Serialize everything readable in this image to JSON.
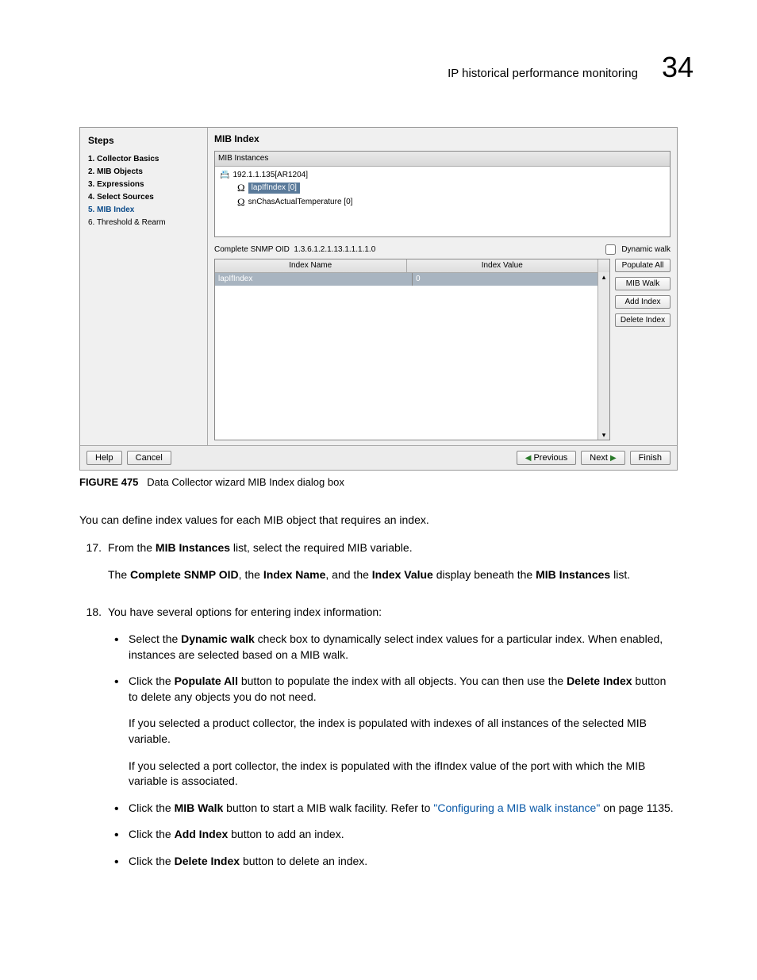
{
  "header": {
    "title": "IP historical performance monitoring",
    "chapter": "34"
  },
  "dialog": {
    "steps_title": "Steps",
    "steps": [
      {
        "label": "1. Collector Basics",
        "style": "bold"
      },
      {
        "label": "2. MIB Objects",
        "style": "bold"
      },
      {
        "label": "3. Expressions",
        "style": "bold"
      },
      {
        "label": "4. Select Sources",
        "style": "bold"
      },
      {
        "label": "5. MIB Index",
        "style": "current"
      },
      {
        "label": "6. Threshold & Rearm",
        "style": ""
      }
    ],
    "main_title": "MIB Index",
    "mib_instances_title": "MIB Instances",
    "tree": {
      "root": "192.1.1.135[AR1204]",
      "child1": "lapIfIndex [0]",
      "child2": "snChasActualTemperature [0]"
    },
    "oid_label": "Complete SNMP OID",
    "oid_value": "1.3.6.1.2.1.13.1.1.1.1.0",
    "dynamic_walk_label": "Dynamic walk",
    "grid": {
      "col1": "Index Name",
      "col2": "Index Value",
      "row": {
        "name": "lapIfIndex",
        "value": "0"
      }
    },
    "buttons": {
      "populate_all": "Populate All",
      "mib_walk": "MIB Walk",
      "add_index": "Add Index",
      "delete_index": "Delete Index"
    },
    "footer": {
      "help": "Help",
      "cancel": "Cancel",
      "previous": "Previous",
      "next": "Next",
      "finish": "Finish"
    }
  },
  "figure": {
    "label": "FIGURE 475",
    "caption": "Data Collector wizard MIB Index dialog box"
  },
  "text": {
    "intro": "You can define index values for each MIB object that requires an index.",
    "s17_num": "17.",
    "s17_a": "From the ",
    "s17_b": "MIB Instances",
    "s17_c": " list, select the required MIB variable.",
    "s17_p2a": "The ",
    "s17_p2b": "Complete SNMP OID",
    "s17_p2c": ", the ",
    "s17_p2d": "Index Name",
    "s17_p2e": ", and the ",
    "s17_p2f": "Index Value",
    "s17_p2g": " display beneath the ",
    "s17_p2h": "MIB Instances",
    "s17_p2i": " list.",
    "s18_num": "18.",
    "s18_intro": "You have several options for entering index information:",
    "b1a": "Select the ",
    "b1b": "Dynamic walk",
    "b1c": " check box to dynamically select index values for a particular index. When enabled, instances are selected based on a MIB walk.",
    "b2a": "Click the ",
    "b2b": "Populate All",
    "b2c": " button to populate the index with all objects. You can then use the ",
    "b2d": "Delete Index",
    "b2e": " button to delete any objects you do not need.",
    "b2p2": "If you selected a product collector, the index is populated with indexes of all instances of the selected MIB variable.",
    "b2p3": "If you selected a port collector, the index is populated with the ifIndex value of the port with which the MIB variable is associated.",
    "b3a": "Click the ",
    "b3b": "MIB Walk",
    "b3c": " button to start a MIB walk facility. Refer to ",
    "b3link": "\"Configuring a MIB walk instance\"",
    "b3d": " on page 1135.",
    "b4a": "Click the ",
    "b4b": "Add Index",
    "b4c": " button to add an index.",
    "b5a": "Click the ",
    "b5b": "Delete Index",
    "b5c": " button to delete an index."
  }
}
